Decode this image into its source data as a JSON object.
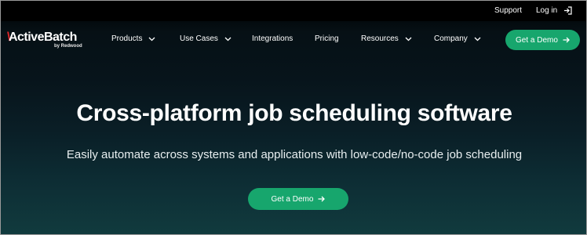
{
  "utility_nav": {
    "support": "Support",
    "login": "Log in"
  },
  "brand": {
    "name": "ActiveBatch",
    "byline": "by Redwood",
    "accent_color": "#e0262a"
  },
  "main_nav": {
    "items": [
      {
        "label": "Products",
        "has_dropdown": true
      },
      {
        "label": "Use Cases",
        "has_dropdown": true
      },
      {
        "label": "Integrations",
        "has_dropdown": false
      },
      {
        "label": "Pricing",
        "has_dropdown": false
      },
      {
        "label": "Resources",
        "has_dropdown": true
      },
      {
        "label": "Company",
        "has_dropdown": true
      }
    ],
    "cta_label": "Get a Demo"
  },
  "hero": {
    "title": "Cross-platform job scheduling software",
    "subtitle": "Easily automate across systems and applications with low-code/no-code job scheduling",
    "cta_label": "Get a Demo"
  },
  "colors": {
    "cta_green": "#17a66d",
    "background_dark": "#07141b"
  },
  "icons": {
    "login": "login-icon",
    "dropdown": "chevron-down-icon",
    "cta_arrow": "arrow-right-icon"
  }
}
